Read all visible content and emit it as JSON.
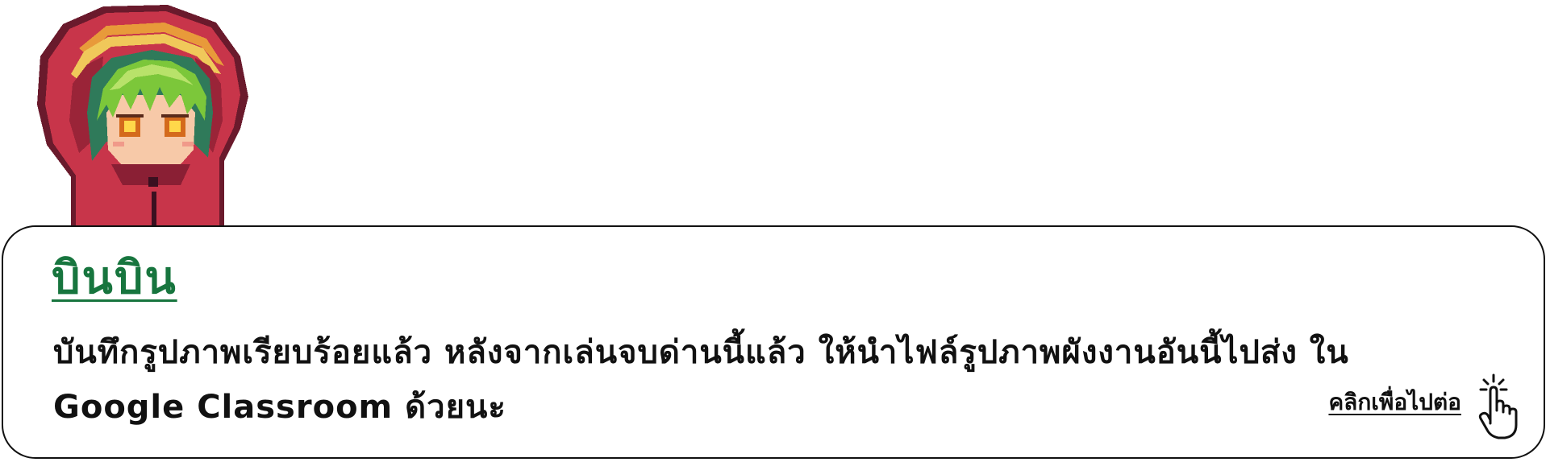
{
  "dialog": {
    "speaker_name": "บินบิน",
    "message": "บันทึกรูปภาพเรียบร้อยแล้ว หลังจากเล่นจบด่านนี้แล้ว ให้นำไฟล์รูปภาพผังงานอันนี้ไปส่ง ใน Google Classroom ด้วยนะ",
    "continue_label": "คลิกเพื่อไปต่อ"
  },
  "character": {
    "icon": "pixel-art-hooded-girl-portrait",
    "hood_color": "#c8354a",
    "hair_color": "#7cc73a"
  },
  "colors": {
    "speaker_name": "#17753e",
    "text": "#111111",
    "border": "#111111"
  },
  "icons": {
    "continue": "pointing-hand-icon"
  }
}
